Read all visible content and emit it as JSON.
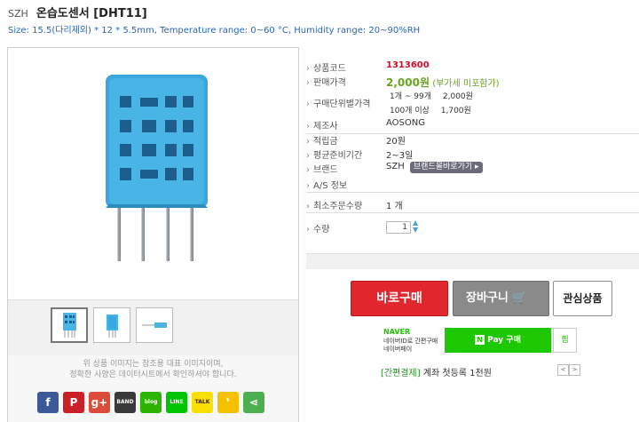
{
  "header": {
    "brand": "SZH",
    "title": "온습도센서 [DHT11]",
    "subtitle": "Size: 15.5(다리제외) * 12 * 5.5mm, Temperature range: 0~60 °C, Humidity range: 20~90%RH"
  },
  "gallery": {
    "thumbnails": [
      "thumb-1",
      "thumb-2",
      "thumb-3"
    ],
    "note_line1": "위 상품 이미지는 참조용 대표 이미지이며,",
    "note_line2": "정확한 사양은 데이터시트에서 확인하셔야 합니다.",
    "share": [
      {
        "name": "facebook",
        "label": "f",
        "color": "#3b5998"
      },
      {
        "name": "pinterest",
        "label": "P",
        "color": "#cb2027"
      },
      {
        "name": "google-plus",
        "label": "g+",
        "color": "#dd4b39"
      },
      {
        "name": "band",
        "label": "BAND",
        "color": "#3a3a3a"
      },
      {
        "name": "blog",
        "label": "blog",
        "color": "#2db400"
      },
      {
        "name": "line",
        "label": "LINE",
        "color": "#00c300"
      },
      {
        "name": "kakaotalk",
        "label": "TALK",
        "color": "#f9e000"
      },
      {
        "name": "kakaostory",
        "label": "❜",
        "color": "#f4c000"
      },
      {
        "name": "share",
        "label": "⋖",
        "color": "#4caf50"
      }
    ]
  },
  "info": {
    "code_label": "상품코드",
    "code": "1313600",
    "price_label": "판매가격",
    "price": "2,000원",
    "price_vat": "(부가세 미포함가)",
    "tier_label": "구매단위별가격",
    "tier1_qty": "1개 ~ 99개",
    "tier1_price": "2,000원",
    "tier2_qty": "100개 이상",
    "tier2_price": "1,700원",
    "maker_label": "제조사",
    "maker": "AOSONG",
    "points_label": "적립금",
    "points": "20원",
    "lead_label": "평균준비기간",
    "lead": "2~3일",
    "brand_label": "브랜드",
    "brand": "SZH",
    "brand_shop": "브랜드몰바로가기 ▸",
    "as_label": "A/S 정보",
    "min_label": "최소주문수량",
    "min": "1 개",
    "qty_label": "수량",
    "qty": "1"
  },
  "actions": {
    "buy": "바로구매",
    "cart": "장바구니 🛒",
    "wish": "관심상품"
  },
  "naver": {
    "logo": "NAVER",
    "line1": "네이버ID로 간편구매",
    "line2": "네이버페이",
    "pay_n": "N",
    "pay": "Pay 구매",
    "zzim": "찜",
    "simple_pay_tag": "[간편결제]",
    "simple_pay_text": " 계좌 첫등록 1천원",
    "prev": "<",
    "next": ">"
  }
}
